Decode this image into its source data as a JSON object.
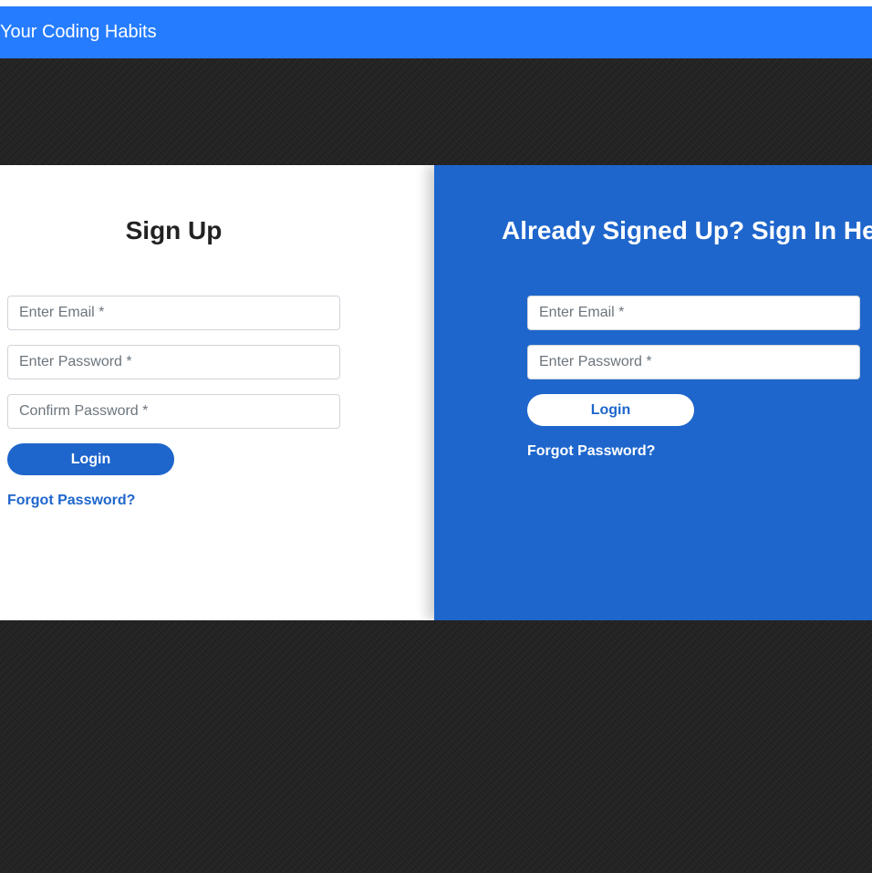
{
  "navbar": {
    "brand": "Your Coding Habits"
  },
  "signup": {
    "title": "Sign Up",
    "email_placeholder": "Enter Email *",
    "password_placeholder": "Enter Password *",
    "confirm_placeholder": "Confirm Password *",
    "button_label": "Login",
    "forgot_label": "Forgot Password?"
  },
  "signin": {
    "title": "Already Signed Up? Sign In Here",
    "email_placeholder": "Enter Email *",
    "password_placeholder": "Enter Password *",
    "button_label": "Login",
    "forgot_label": "Forgot Password?"
  },
  "colors": {
    "navbar": "#257cff",
    "panel_blue": "#1e66cc",
    "background": "#222222"
  }
}
